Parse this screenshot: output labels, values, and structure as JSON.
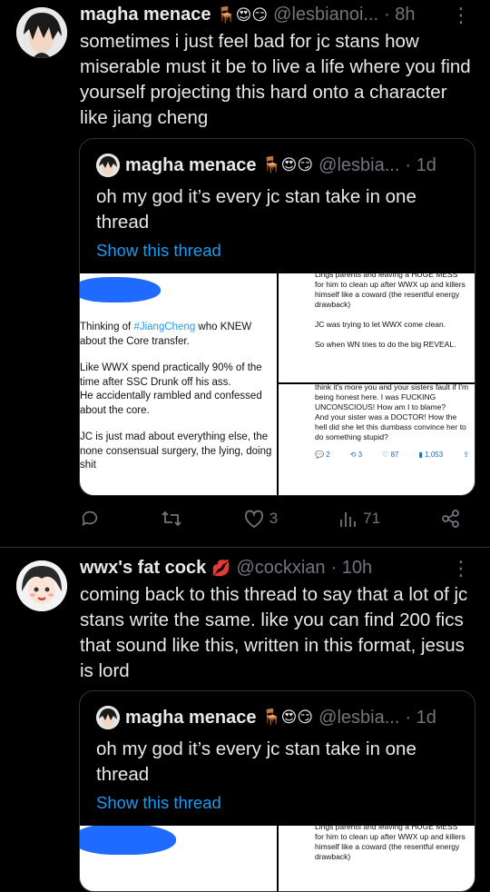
{
  "tweet1": {
    "name": "magha menace",
    "emojis": "🪑😍😏",
    "handle": "@lesbianoi...",
    "time": "· 8h",
    "text": "sometimes i just feel bad for jc stans how miserable must it be to live a life where you find yourself projecting this hard onto a character like jiang cheng",
    "quote": {
      "name": "magha menace",
      "emojis": "🪑😍😏",
      "handle": "@lesbia...",
      "time": "· 1d",
      "text": "oh my god it’s every jc stan take in one thread",
      "link": "Show this thread"
    },
    "image_left": {
      "line1_pre": "Thinking of ",
      "hashtag": "#JiangCheng",
      "line1_post": " who KNEW",
      "line2": "about the Core transfer.",
      "line3": "Like WWX spend practically 90% of the",
      "line4": "time after SSC Drunk off his ass.",
      "line5": "He accidentally rambled and confessed",
      "line6": "about the core.",
      "line7": "JC is just mad about everything else, the",
      "line8": "none consensual surgery, the lying, doing",
      "line9": "shit"
    },
    "image_top_right": {
      "text1": "Lings parents and leaving a HUGE MESS for him to clean up after WWX up and killers himself like a coward (the resentful energy drawback)",
      "text2": "JC was trying to let WWX come clean.",
      "text3": "So when WN tries to do the big REVEAL."
    },
    "image_bottom_right": {
      "text1": "think it's more you and your sisters fault if I'm being honest here. I was FUCKING UNCONSCIOUS! How am I to blame?",
      "text2": "And your sister was a DOCTOR! How the hell did she let this dumbass convince her to do something stupid?",
      "stat_replies": "2",
      "stat_rts": "3",
      "stat_likes": "87",
      "stat_views": "1,053"
    },
    "actions": {
      "likes": "3",
      "views": "71"
    }
  },
  "tweet2": {
    "name": "wwx's fat cock",
    "emojis": "💋",
    "handle": "@cockxian",
    "time": "· 10h",
    "text": "coming back to this thread to say that a lot of jc stans write the same. like you can find 200 fics that sound like this, written in this format,  jesus is lord",
    "quote": {
      "name": "magha menace",
      "emojis": "🪑😍😏",
      "handle": "@lesbia...",
      "time": "· 1d",
      "text": "oh my god it’s every jc stan take in one thread",
      "link": "Show this thread"
    },
    "image_top_right": {
      "text1": "Lings parents and leaving a HUGE MESS for him to clean up after WWX up and killers himself like a coward (the resentful energy drawback)"
    }
  },
  "colors": {
    "accent": "#1d9bf0",
    "muted": "#71767b",
    "border": "#2f3336",
    "background": "#000000"
  }
}
